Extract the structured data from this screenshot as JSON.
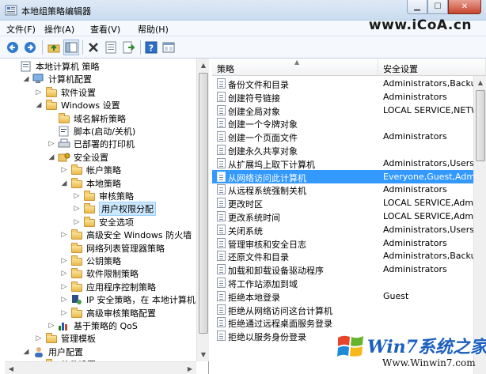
{
  "window": {
    "title": "本地组策略编辑器"
  },
  "menu": [
    {
      "label": "文件(F)"
    },
    {
      "label": "操作(A)"
    },
    {
      "label": "查看(V)"
    },
    {
      "label": "帮助(H)"
    }
  ],
  "watermark_top": "www.iCoA.cn",
  "watermark_bottom": {
    "brand_text": "Win7系统之家",
    "url": "Www.Winwin7.com"
  },
  "toolbar_icons": [
    "back-icon",
    "forward-icon",
    "up-folder-icon",
    "show-hide-tree-icon",
    "delete-icon",
    "properties-icon",
    "export-icon",
    "help-icon",
    "console-icon"
  ],
  "tree": [
    {
      "label": "本地计算机 策略",
      "icon": "computer-policy-icon",
      "toggle": ""
    },
    {
      "label": "计算机配置",
      "icon": "computer-icon",
      "toggle": "◢"
    },
    {
      "label": "软件设置",
      "icon": "folder-icon",
      "toggle": "▷"
    },
    {
      "label": "Windows 设置",
      "icon": "folder-icon",
      "toggle": "◢"
    },
    {
      "label": "域名解析策略",
      "icon": "folder-icon",
      "toggle": ""
    },
    {
      "label": "脚本(启动/关机)",
      "icon": "script-icon",
      "toggle": ""
    },
    {
      "label": "已部署的打印机",
      "icon": "printer-icon",
      "toggle": "▷"
    },
    {
      "label": "安全设置",
      "icon": "security-icon",
      "toggle": "◢"
    },
    {
      "label": "帐户策略",
      "icon": "folder-icon",
      "toggle": "▷"
    },
    {
      "label": "本地策略",
      "icon": "folder-icon",
      "toggle": "◢"
    },
    {
      "label": "审核策略",
      "icon": "folder-icon",
      "toggle": "▷"
    },
    {
      "label": "用户权限分配",
      "icon": "folder-icon",
      "toggle": "▷",
      "selected": true
    },
    {
      "label": "安全选项",
      "icon": "folder-icon",
      "toggle": "▷"
    },
    {
      "label": "高级安全 Windows 防火墙",
      "icon": "folder-icon",
      "toggle": "▷"
    },
    {
      "label": "网络列表管理器策略",
      "icon": "folder-icon",
      "toggle": ""
    },
    {
      "label": "公钥策略",
      "icon": "folder-icon",
      "toggle": "▷"
    },
    {
      "label": "软件限制策略",
      "icon": "folder-icon",
      "toggle": "▷"
    },
    {
      "label": "应用程序控制策略",
      "icon": "folder-icon",
      "toggle": "▷"
    },
    {
      "label": "IP 安全策略，在 本地计算机",
      "icon": "ip-security-icon",
      "toggle": "▷"
    },
    {
      "label": "高级审核策略配置",
      "icon": "folder-icon",
      "toggle": "▷"
    },
    {
      "label": "基于策略的 QoS",
      "icon": "qos-chart-icon",
      "toggle": "▷"
    },
    {
      "label": "管理模板",
      "icon": "folder-icon",
      "toggle": "▷"
    },
    {
      "label": "用户配置",
      "icon": "user-icon",
      "toggle": "◢"
    },
    {
      "label": "软件设置",
      "icon": "folder-icon",
      "toggle": "▷"
    }
  ],
  "list_headers": {
    "policy": "策略",
    "setting": "安全设置"
  },
  "policies": [
    {
      "name": "备份文件和目录",
      "setting": "Administrators,Backup ..."
    },
    {
      "name": "创建符号链接",
      "setting": "Administrators"
    },
    {
      "name": "创建全局对象",
      "setting": "LOCAL SERVICE,NETWO..."
    },
    {
      "name": "创建一个令牌对象",
      "setting": ""
    },
    {
      "name": "创建一个页面文件",
      "setting": "Administrators"
    },
    {
      "name": "创建永久共享对象",
      "setting": ""
    },
    {
      "name": "从扩展坞上取下计算机",
      "setting": "Administrators,Users"
    },
    {
      "name": "从网络访问此计算机",
      "setting": "Everyone,Guest,Adminis...",
      "selected": true
    },
    {
      "name": "从远程系统强制关机",
      "setting": "Administrators"
    },
    {
      "name": "更改时区",
      "setting": "LOCAL SERVICE,Admini..."
    },
    {
      "name": "更改系统时间",
      "setting": "LOCAL SERVICE,Admini..."
    },
    {
      "name": "关闭系统",
      "setting": "Administrators,Users,Ba..."
    },
    {
      "name": "管理审核和安全日志",
      "setting": "Administrators"
    },
    {
      "name": "还原文件和目录",
      "setting": "Administrators,Backup ..."
    },
    {
      "name": "加载和卸载设备驱动程序",
      "setting": "Administrators"
    },
    {
      "name": "将工作站添加到域",
      "setting": ""
    },
    {
      "name": "拒绝本地登录",
      "setting": "Guest"
    },
    {
      "name": "拒绝从网络访问这台计算机",
      "setting": ""
    },
    {
      "name": "拒绝通过远程桌面服务登录",
      "setting": ""
    },
    {
      "name": "拒绝以服务身份登录",
      "setting": ""
    }
  ]
}
